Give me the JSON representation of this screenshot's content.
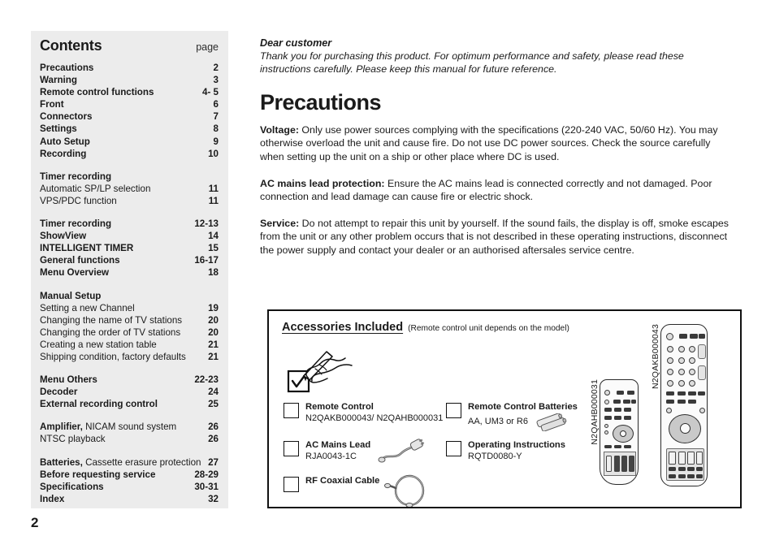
{
  "page_number": "2",
  "contents": {
    "title": "Contents",
    "page_label": "page",
    "groups": [
      {
        "rows": [
          {
            "label": "Precautions",
            "page": "2",
            "bold": true
          },
          {
            "label": "Warning",
            "page": "3",
            "bold": true
          },
          {
            "label": "Remote control functions",
            "page": "4- 5",
            "bold": true
          },
          {
            "label": "Front",
            "page": "6",
            "bold": true
          },
          {
            "label": "Connectors",
            "page": "7",
            "bold": true
          },
          {
            "label": "Settings",
            "page": "8",
            "bold": true
          },
          {
            "label": "Auto Setup",
            "page": "9",
            "bold": true
          },
          {
            "label": "Recording",
            "page": "10",
            "bold": true
          }
        ]
      },
      {
        "rows": [
          {
            "label": "Timer recording",
            "page": "",
            "bold": true
          },
          {
            "label": "Automatic SP/LP selection",
            "page": "11",
            "bold": false
          },
          {
            "label": "VPS/PDC function",
            "page": "11",
            "bold": false
          }
        ]
      },
      {
        "rows": [
          {
            "label": "Timer recording",
            "page": "12-13",
            "bold": true
          },
          {
            "label": "ShowView",
            "page": "14",
            "bold": true
          },
          {
            "label": "INTELLIGENT TIMER",
            "page": "15",
            "bold": true
          },
          {
            "label": "General functions",
            "page": "16-17",
            "bold": true
          },
          {
            "label": "Menu Overview",
            "page": "18",
            "bold": true
          }
        ]
      },
      {
        "rows": [
          {
            "label": "Manual Setup",
            "page": "",
            "bold": true
          },
          {
            "label": "Setting a new Channel",
            "page": "19",
            "bold": false
          },
          {
            "label": "Changing the name of TV stations",
            "page": "20",
            "bold": false
          },
          {
            "label": "Changing the order of TV stations",
            "page": "20",
            "bold": false
          },
          {
            "label": "Creating a new station table",
            "page": "21",
            "bold": false
          },
          {
            "label": "Shipping condition, factory defaults",
            "page": "21",
            "bold": false
          }
        ]
      },
      {
        "rows": [
          {
            "label": "Menu Others",
            "page": "22-23",
            "bold": true
          },
          {
            "label": "Decoder",
            "page": "24",
            "bold": true
          },
          {
            "label": "External recording control",
            "page": "25",
            "bold": true
          }
        ]
      },
      {
        "rows": [
          {
            "label_bold": "Amplifier,",
            "label_normal": " NICAM  sound system",
            "page": "26",
            "mixed": true
          },
          {
            "label": "NTSC playback",
            "page": "26",
            "bold": false
          }
        ]
      },
      {
        "rows": [
          {
            "label_bold": "Batteries,",
            "label_normal": " Cassette erasure protection",
            "page": "27",
            "mixed": true
          },
          {
            "label": "Before requesting service",
            "page": "28-29",
            "bold": true
          },
          {
            "label": "Specifications",
            "page": "30-31",
            "bold": true
          },
          {
            "label": "Index",
            "page": "32",
            "bold": true
          }
        ]
      }
    ]
  },
  "dear_customer": {
    "title": "Dear customer",
    "body": "Thank you for purchasing this product. For optimum performance and safety, please read these instructions carefully. Please keep this manual for future reference."
  },
  "precautions": {
    "heading": "Precautions",
    "paragraphs": [
      {
        "term": "Voltage:",
        "text": " Only use power sources complying with the specifications (220-240 VAC, 50/60 Hz). You may otherwise overload the unit and cause fire. Do not use DC power sources. Check the source carefully when setting up the unit on a ship or other place where DC is used."
      },
      {
        "term": "AC mains lead protection:",
        "text": " Ensure the AC mains lead is connected correctly and not damaged. Poor connection and lead damage can cause fire or electric shock."
      },
      {
        "term": "Service:",
        "text": " Do not attempt to repair this unit by yourself. If the sound fails, the display is off, smoke escapes from the unit or any other problem occurs that is not described in these operating instructions, disconnect the power supply and contact your dealer or an authorised aftersales service centre."
      }
    ]
  },
  "accessories": {
    "title": "Accessories Included",
    "subtitle": "(Remote control unit depends on the model)",
    "items": [
      {
        "name": "Remote Control",
        "sub": "N2QAKB000043/ N2QAHB000031",
        "figure": "none"
      },
      {
        "name": "Remote Control Batteries",
        "sub": "AA, UM3 or R6",
        "figure": "batteries-icon"
      },
      {
        "name": "AC Mains Lead",
        "sub": "RJA0043-1C",
        "figure": "power-cord-icon"
      },
      {
        "name": "Operating Instructions",
        "sub": "RQTD0080-Y",
        "figure": "none"
      },
      {
        "name": "RF Coaxial Cable",
        "sub": "",
        "figure": "coaxial-cable-icon"
      }
    ],
    "remotes": [
      {
        "caption": "N2QAHB000031"
      },
      {
        "caption": "N2QAKB000043"
      }
    ]
  },
  "colors": {
    "panel_background": "#ececec",
    "text": "#1a1a1a",
    "box_border": "#111111"
  }
}
